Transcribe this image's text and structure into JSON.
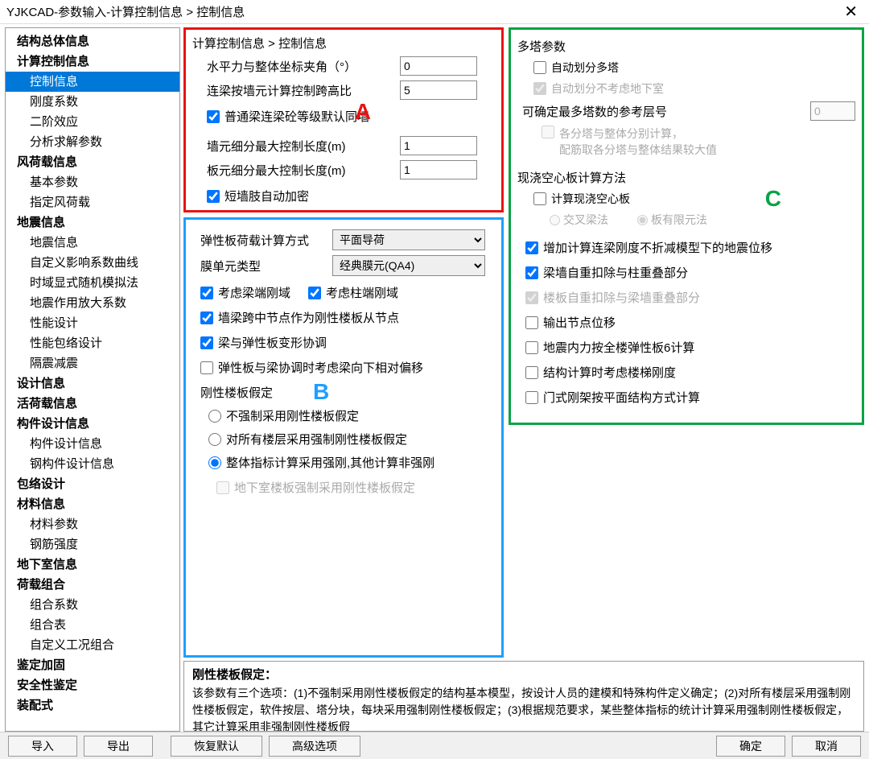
{
  "window": {
    "title": "YJKCAD-参数输入-计算控制信息 > 控制信息"
  },
  "tree": {
    "items": [
      {
        "label": "结构总体信息",
        "bold": true
      },
      {
        "label": "计算控制信息",
        "bold": true
      },
      {
        "label": "控制信息",
        "child": true,
        "selected": true
      },
      {
        "label": "刚度系数",
        "child": true
      },
      {
        "label": "二阶效应",
        "child": true
      },
      {
        "label": "分析求解参数",
        "child": true
      },
      {
        "label": "风荷载信息",
        "bold": true
      },
      {
        "label": "基本参数",
        "child": true
      },
      {
        "label": "指定风荷载",
        "child": true
      },
      {
        "label": "地震信息",
        "bold": true
      },
      {
        "label": "地震信息",
        "child": true
      },
      {
        "label": "自定义影响系数曲线",
        "child": true
      },
      {
        "label": "时域显式随机模拟法",
        "child": true
      },
      {
        "label": "地震作用放大系数",
        "child": true
      },
      {
        "label": "性能设计",
        "child": true
      },
      {
        "label": "性能包络设计",
        "child": true
      },
      {
        "label": "隔震减震",
        "child": true
      },
      {
        "label": "设计信息",
        "bold": true
      },
      {
        "label": "活荷载信息",
        "bold": true
      },
      {
        "label": "构件设计信息",
        "bold": true
      },
      {
        "label": "构件设计信息",
        "child": true
      },
      {
        "label": "钢构件设计信息",
        "child": true
      },
      {
        "label": "包络设计",
        "bold": true
      },
      {
        "label": "材料信息",
        "bold": true
      },
      {
        "label": "材料参数",
        "child": true
      },
      {
        "label": "钢筋强度",
        "child": true
      },
      {
        "label": "地下室信息",
        "bold": true
      },
      {
        "label": "荷载组合",
        "bold": true
      },
      {
        "label": "组合系数",
        "child": true
      },
      {
        "label": "组合表",
        "child": true
      },
      {
        "label": "自定义工况组合",
        "child": true
      },
      {
        "label": "鉴定加固",
        "bold": true
      },
      {
        "label": "安全性鉴定",
        "bold": true
      },
      {
        "label": "装配式",
        "bold": true
      }
    ]
  },
  "breadcrumb": "计算控制信息 > 控制信息",
  "panelA": {
    "row1": {
      "label": "水平力与整体坐标夹角（°）",
      "value": "0"
    },
    "row2": {
      "label": "连梁按墙元计算控制跨高比",
      "value": "5"
    },
    "chk1": {
      "label": "普通梁连梁砼等级默认同墙",
      "checked": true
    },
    "row3": {
      "label": "墙元细分最大控制长度(m)",
      "value": "1"
    },
    "row4": {
      "label": "板元细分最大控制长度(m)",
      "value": "1"
    },
    "chk2": {
      "label": "短墙肢自动加密",
      "checked": true
    }
  },
  "panelB": {
    "sel1": {
      "label": "弹性板荷载计算方式",
      "value": "平面导荷"
    },
    "sel2": {
      "label": "膜单元类型",
      "value": "经典膜元(QA4)"
    },
    "chk1": {
      "label": "考虑梁端刚域",
      "checked": true
    },
    "chk2": {
      "label": "考虑柱端刚域",
      "checked": true
    },
    "chk3": {
      "label": "墙梁跨中节点作为刚性楼板从节点",
      "checked": true
    },
    "chk4": {
      "label": "梁与弹性板变形协调",
      "checked": true
    },
    "chk5": {
      "label": "弹性板与梁协调时考虑梁向下相对偏移",
      "checked": false
    },
    "rigidTitle": "刚性楼板假定",
    "r1": "不强制采用刚性楼板假定",
    "r2": "对所有楼层采用强制刚性楼板假定",
    "r3": "整体指标计算采用强刚,其他计算非强刚",
    "chk6": {
      "label": "地下室楼板强制采用刚性楼板假定",
      "checked": false
    }
  },
  "panelC": {
    "sec1": "多塔参数",
    "chk1": {
      "label": "自动划分多塔",
      "checked": false
    },
    "chk2": {
      "label": "自动划分不考虑地下室",
      "checked": true
    },
    "floorLabel": "可确定最多塔数的参考层号",
    "floorValue": "0",
    "chk3": {
      "label": "各分塔与整体分别计算，\n配筋取各分塔与整体结果较大值",
      "checked": false
    },
    "sec2": "现浇空心板计算方法",
    "chk4": {
      "label": "计算现浇空心板",
      "checked": false
    },
    "r1": "交叉梁法",
    "r2": "板有限元法",
    "chk5": {
      "label": "增加计算连梁刚度不折减模型下的地震位移",
      "checked": true
    },
    "chk6": {
      "label": "梁墙自重扣除与柱重叠部分",
      "checked": true
    },
    "chk7": {
      "label": "楼板自重扣除与梁墙重叠部分",
      "checked": true
    },
    "chk8": {
      "label": "输出节点位移",
      "checked": false
    },
    "chk9": {
      "label": "地震内力按全楼弹性板6计算",
      "checked": false
    },
    "chk10": {
      "label": "结构计算时考虑楼梯刚度",
      "checked": false
    },
    "chk11": {
      "label": "门式刚架按平面结构方式计算",
      "checked": false
    }
  },
  "desc": {
    "title": "刚性楼板假定：",
    "text": "该参数有三个选项：(1)不强制采用刚性楼板假定的结构基本模型，按设计人员的建模和特殊构件定义确定；(2)对所有楼层采用强制刚性楼板假定，软件按层、塔分块，每块采用强制刚性楼板假定；(3)根据规范要求，某些整体指标的统计计算采用强制刚性楼板假定，其它计算采用非强制刚性楼板假"
  },
  "buttons": {
    "import": "导入",
    "export": "导出",
    "restore": "恢复默认",
    "advanced": "高级选项",
    "ok": "确定",
    "cancel": "取消"
  },
  "letters": {
    "a": "A",
    "b": "B",
    "c": "C"
  }
}
